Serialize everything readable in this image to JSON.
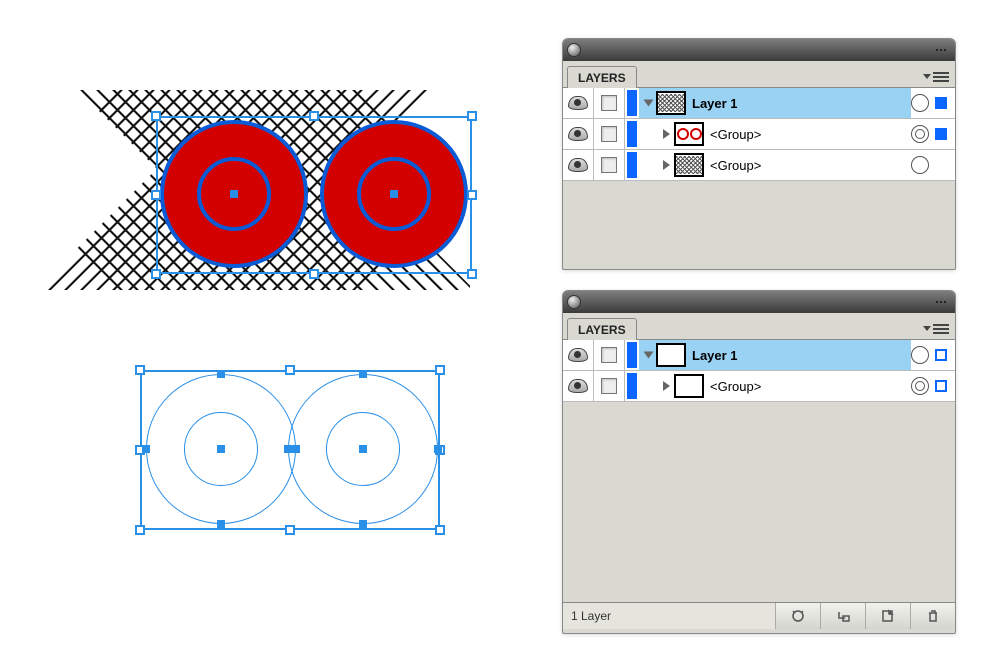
{
  "panel1": {
    "tab": "LAYERS",
    "rows": [
      {
        "name": "Layer 1",
        "thumb": "hatch",
        "disclose": "open",
        "bold": true,
        "selected": true,
        "target": "off",
        "sel": "filled",
        "indent": 0
      },
      {
        "name": "<Group>",
        "thumb": "rings",
        "disclose": "closed",
        "bold": false,
        "selected": false,
        "target": "on",
        "sel": "filled",
        "indent": 1
      },
      {
        "name": "<Group>",
        "thumb": "hatch",
        "disclose": "closed",
        "bold": false,
        "selected": false,
        "target": "off",
        "sel": "none",
        "indent": 1
      }
    ]
  },
  "panel2": {
    "tab": "LAYERS",
    "rows": [
      {
        "name": "Layer 1",
        "thumb": "white",
        "disclose": "open",
        "bold": true,
        "selected": true,
        "target": "off",
        "sel": "hollow",
        "indent": 0
      },
      {
        "name": "<Group>",
        "thumb": "white",
        "disclose": "closed",
        "bold": false,
        "selected": false,
        "target": "on",
        "sel": "hollow",
        "indent": 1
      }
    ],
    "footer_status": "1 Layer"
  },
  "icons": {
    "new_sublayer": "new-sublayer-icon",
    "new_layer": "new-layer-icon",
    "trash": "trash-icon",
    "clip": "make-clipping-mask-icon"
  }
}
